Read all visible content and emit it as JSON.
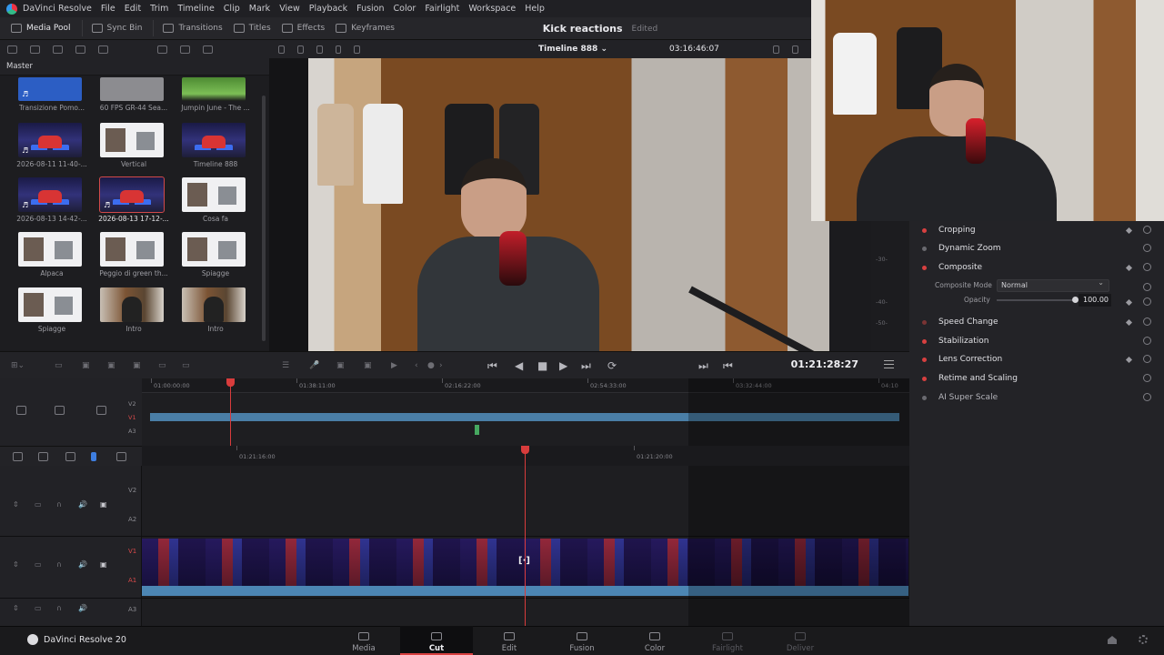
{
  "app": {
    "menu": [
      "DaVinci Resolve",
      "File",
      "Edit",
      "Trim",
      "Timeline",
      "Clip",
      "Mark",
      "View",
      "Playback",
      "Fusion",
      "Color",
      "Fairlight",
      "Workspace",
      "Help"
    ],
    "toolbar": {
      "media_pool": "Media Pool",
      "sync_bin": "Sync Bin",
      "transitions": "Transitions",
      "titles": "Titles",
      "effects": "Effects",
      "keyframes": "Keyframes"
    },
    "project_title": "Kick reactions",
    "project_state": "Edited"
  },
  "media_pool": {
    "bin": "Master",
    "clips": [
      {
        "label": "Transizione Pomo...",
        "thumb": "blue",
        "audio": true
      },
      {
        "label": "60 FPS GR-44 Sea...",
        "thumb": "gray",
        "audio": false
      },
      {
        "label": "Jumpin June - The ...",
        "thumb": "green",
        "audio": false
      },
      {
        "label": "2026-08-11 11-40-...",
        "thumb": "stage",
        "audio": true
      },
      {
        "label": "Vertical",
        "thumb": "white",
        "audio": false
      },
      {
        "label": "Timeline 888",
        "thumb": "stage",
        "audio": false
      },
      {
        "label": "2026-08-13 14-42-...",
        "thumb": "stage",
        "audio": true
      },
      {
        "label": "2026-08-13 17-12-...",
        "thumb": "stage",
        "audio": true,
        "selected": true
      },
      {
        "label": "Cosa fa",
        "thumb": "white",
        "audio": false
      },
      {
        "label": "Alpaca",
        "thumb": "white",
        "audio": false
      },
      {
        "label": "Peggio di green th...",
        "thumb": "white",
        "audio": false
      },
      {
        "label": "Spiagge",
        "thumb": "white",
        "audio": false
      },
      {
        "label": "Spiagge",
        "thumb": "white",
        "audio": false
      },
      {
        "label": "Intro",
        "thumb": "room",
        "audio": false
      },
      {
        "label": "Intro",
        "thumb": "room",
        "audio": false
      }
    ]
  },
  "viewer": {
    "timeline_name": "Timeline 888 ⌄",
    "timecode_top": "03:16:46:07"
  },
  "inspector": {
    "scale_labels": [
      "-30-",
      "-40-",
      "-50-"
    ],
    "sections": [
      {
        "title": "Cropping",
        "dot": "on",
        "keyframe": true
      },
      {
        "title": "Dynamic Zoom",
        "dot": "off",
        "keyframe": false
      },
      {
        "title": "Composite",
        "dot": "on",
        "keyframe": true
      },
      {
        "title": "Speed Change",
        "dot": "dim",
        "keyframe": true
      },
      {
        "title": "Stabilization",
        "dot": "on",
        "keyframe": false
      },
      {
        "title": "Lens Correction",
        "dot": "on",
        "keyframe": true
      },
      {
        "title": "Retime and Scaling",
        "dot": "on",
        "keyframe": false
      },
      {
        "title": "AI Super Scale",
        "dot": "off",
        "keyframe": false
      }
    ],
    "composite_mode_label": "Composite Mode",
    "composite_mode_value": "Normal",
    "opacity_label": "Opacity",
    "opacity_value": "100.00",
    "opacity_fraction": 1.0
  },
  "transport": {
    "timecode": "01:21:28:27"
  },
  "timeline_upper": {
    "ruler": [
      "01:00:00:00",
      "01:38:11:00",
      "02:16:22:00",
      "02:54:33:00",
      "03:32:44:00",
      "04:10"
    ],
    "tracks": [
      "V2",
      "V1",
      "A3"
    ]
  },
  "timeline_lower": {
    "ruler": [
      "01:21:16:00",
      "01:21:20:00"
    ],
    "tracks": [
      {
        "video": "V2",
        "audio": "A2"
      },
      {
        "video": "V1",
        "audio": "A1"
      },
      {
        "video": "",
        "audio": "A3"
      }
    ]
  },
  "pages": {
    "brand": "DaVinci Resolve 20",
    "items": [
      {
        "label": "Media",
        "state": "normal"
      },
      {
        "label": "Cut",
        "state": "active"
      },
      {
        "label": "Edit",
        "state": "normal"
      },
      {
        "label": "Fusion",
        "state": "normal"
      },
      {
        "label": "Color",
        "state": "normal"
      },
      {
        "label": "Fairlight",
        "state": "off"
      },
      {
        "label": "Deliver",
        "state": "off"
      }
    ]
  },
  "colors": {
    "accent_red": "#d84040",
    "clip_blue": "#4a7ea6"
  }
}
